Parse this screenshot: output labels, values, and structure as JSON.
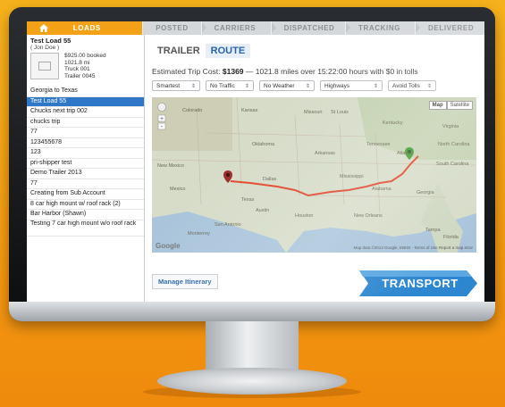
{
  "nav": {
    "home_icon": "home-icon",
    "tabs": [
      {
        "label": "LOADS",
        "active": true
      },
      {
        "label": "POSTED"
      },
      {
        "label": "CARRIERS"
      },
      {
        "label": "DISPATCHED"
      },
      {
        "label": "TRACKING"
      },
      {
        "label": "DELIVERED"
      }
    ]
  },
  "sidebar": {
    "load": {
      "title": "Test Load 55",
      "owner": "( Jon Doe )",
      "details": [
        "$925.00 booked",
        "1021.8 mi",
        "Truck 001",
        "Trailer 0045"
      ]
    },
    "items": [
      "Georgia to Texas",
      "Test Load 55",
      "Chucks next trip 002",
      "chucks trip",
      "77",
      "123455678",
      "123",
      "pri-shipper test",
      "Demo Trailer 2013",
      "77",
      "Creating from Sub Account",
      "8 car high mount w/ roof rack (2)",
      "Bar Harbor (Shawn)",
      "Testing 7 car high mount w/o roof rack"
    ],
    "selected_index": 1
  },
  "main": {
    "tabs": [
      {
        "label": "TRAILER"
      },
      {
        "label": "ROUTE",
        "active": true
      }
    ],
    "cost_prefix": "Estimated Trip Cost: ",
    "cost_value": "$1369",
    "cost_suffix": " — 1021.8 miles over 15:22:00 hours with $0 in tolls",
    "options": [
      "Smartest",
      "No Traffic",
      "No Weather",
      "Highways",
      "Avoid Tolls"
    ],
    "map": {
      "buttons": [
        "Map",
        "Satellite"
      ],
      "google": "Google",
      "footer": "Map data ©2013 Google, INEGI - Terms of Use  Report a map error",
      "labels": [
        "Colorado",
        "Kansas",
        "Missouri",
        "St Louis",
        "Kentucky",
        "Virginia",
        "Oklahoma",
        "Tennessee",
        "North Carolina",
        "Arkansas",
        "New Mexico",
        "Dallas",
        "Mississippi",
        "Atlanta",
        "South Carolina",
        "Alabama",
        "Georgia",
        "Texas",
        "Austin",
        "Houston",
        "New Orleans",
        "San Antonio",
        "Tampa",
        "Florida",
        "Mexico",
        "Monterrey"
      ]
    },
    "manage_label": "Manage Itinerary",
    "transport_label": "TRANSPORT"
  },
  "colors": {
    "accent": "#f3a217",
    "primary_blue": "#2a64a8",
    "selected_row": "#2f78c8",
    "route": "#e0452a"
  }
}
